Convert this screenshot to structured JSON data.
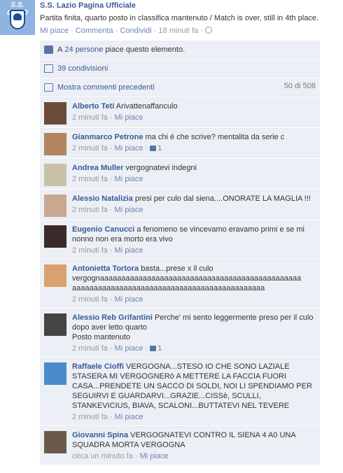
{
  "post": {
    "page_name": "S.S. Lazio Pagina Ufficiale",
    "avatar_text": "S.S. LAZIO",
    "text": "Partita finita, quarto posto in classifica mantenuto / Match is over, still in 4th place.",
    "like_label": "Mi piace",
    "comment_label": "Commenta",
    "share_label": "Condividi",
    "time": "18 minuti fa",
    "sep": "·"
  },
  "ufi": {
    "likes_prefix": "A ",
    "likes_link": "24 persone",
    "likes_suffix": " piace questo elemento.",
    "shares": "39 condivisioni",
    "prev_comments": "Mostra commenti precedenti",
    "count": "50 di 508"
  },
  "comments": [
    {
      "name": "Alberto Teti",
      "text": "Arivattenaffanculo",
      "time": "2 minuti fa",
      "like": "Mi piace",
      "likes": "",
      "avatar_color": "#6b4a3a"
    },
    {
      "name": "Gianmarco Petrone",
      "text": "ma chi è che scrive? mentalita da serie c",
      "time": "2 minuti fa",
      "like": "Mi piace",
      "likes": "1",
      "avatar_color": "#b08560"
    },
    {
      "name": "Andrea Muller",
      "text": "vergognatevi indegni",
      "time": "2 minuti fa",
      "like": "Mi piace",
      "likes": "",
      "avatar_color": "#c9c2a8"
    },
    {
      "name": "Alessio Natalizia",
      "text": "presi per culo dal siena....ONORATE LA MAGLIA !!!",
      "time": "2 minuti fa",
      "like": "Mi piace",
      "likes": "",
      "avatar_color": "#c8a890"
    },
    {
      "name": "Eugenio Canucci",
      "text": "a fenomeno se vincevamo eravamo primi e se mi nonno non era morto era vivo",
      "time": "2 minuti fa",
      "like": "Mi piace",
      "likes": "",
      "avatar_color": "#3a2a2a"
    },
    {
      "name": "Antonietta Tortora",
      "text": "basta...prese x il culo vergognaaaaaaaaaaaaaaaaaaaaaaaaaaaaaaaaaaaaaaaaaaaaaaa aaaaaaaaaaaaaaaaaaaaaaaaaaaaaaaaaaaaaaaaaaaaa",
      "time": "2 minuti fa",
      "like": "Mi piace",
      "likes": "",
      "avatar_color": "#d9a070"
    },
    {
      "name": "Alessio Reb Grifantini",
      "text": "Perche' mi sento leggermente preso per il culo dopo aver letto quarto\nPosto mantenuto",
      "time": "2 minuti fa",
      "like": "Mi piace",
      "likes": "1",
      "avatar_color": "#444444"
    },
    {
      "name": "Raffaele Cioffi",
      "text": "VERGOGNA...STESO IO CHE SONO LAZIALE STASERA MI VERGOGNERò A METTERE LA FACCIA FUORI CASA...PRENDETE UN SACCO DI SOLDI, NOI LI SPENDIAMO PER SEGUIRVI E GUARDARVI...GRAZIE...CISSè, SCULLI, STANKEVICIUS, BIAVA, SCALONI...BUTTATEVI NEL TEVERE",
      "time": "2 minuti fa",
      "like": "Mi piace",
      "likes": "",
      "avatar_color": "#4a8ac8"
    },
    {
      "name": "Giovanni Spina",
      "text": "VERGOGNATEVI CONTRO IL SIENA 4 A0 UNA SQUADRA MORTA VERGOGNA",
      "time": "circa un minuto fa",
      "like": "Mi piace",
      "likes": "",
      "avatar_color": "#6a5a4a"
    }
  ]
}
